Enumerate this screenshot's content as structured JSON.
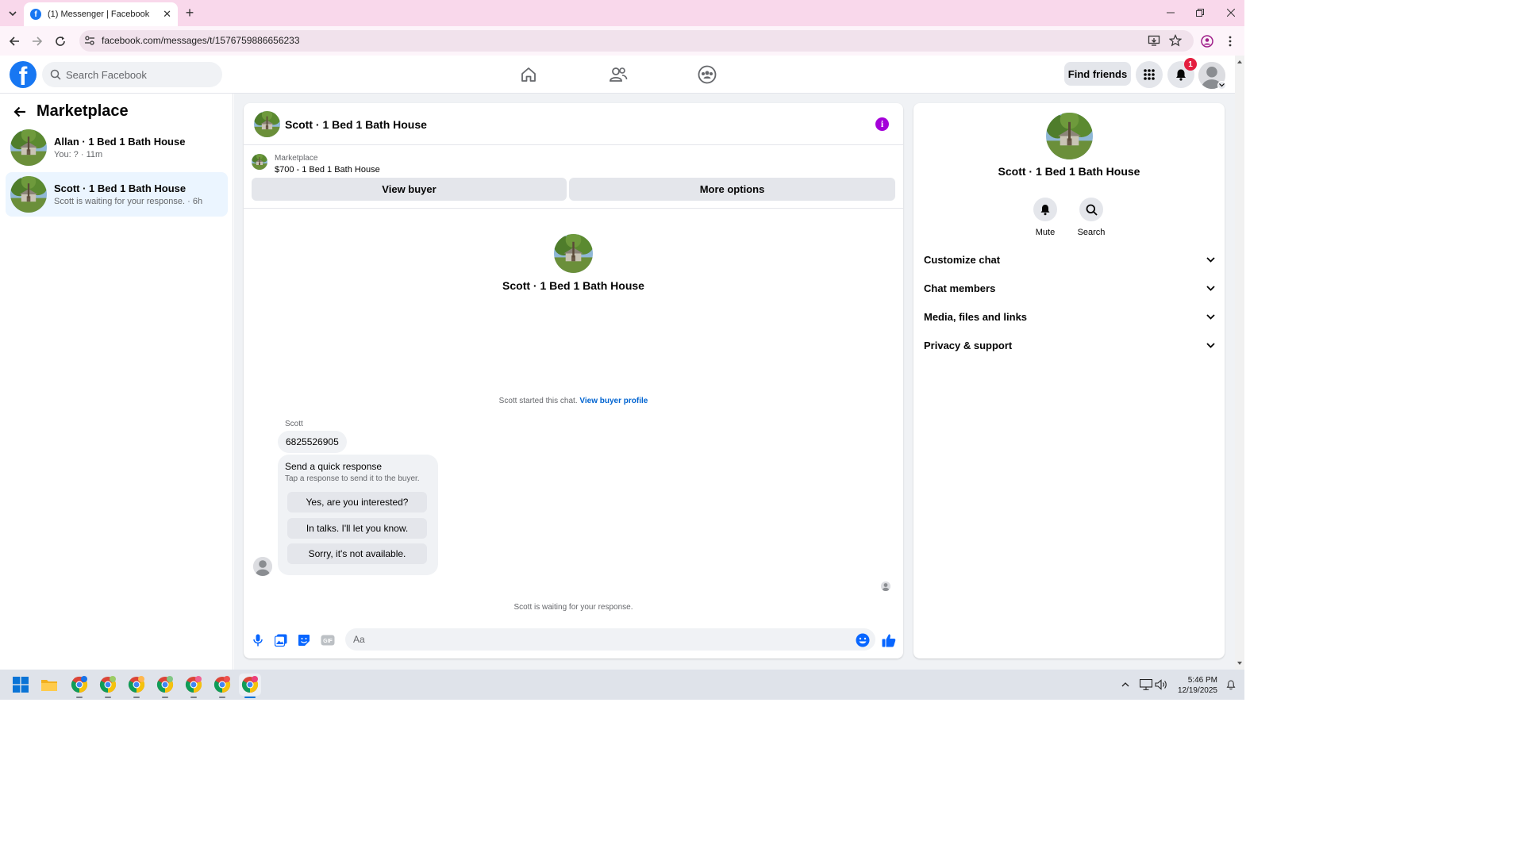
{
  "browser": {
    "tab_title": "(1) Messenger | Facebook",
    "url": "facebook.com/messages/t/1576759886656233"
  },
  "fb_header": {
    "search_placeholder": "Search Facebook",
    "find_friends": "Find friends",
    "notification_count": "1"
  },
  "sidebar": {
    "title": "Marketplace",
    "conversations": [
      {
        "name": "Allan · 1 Bed 1 Bath House",
        "preview": "You: ? · 11m",
        "active": false
      },
      {
        "name": "Scott · 1 Bed 1 Bath House",
        "preview": "Scott is waiting for your response. · 6h",
        "active": true
      }
    ]
  },
  "chat": {
    "header_title": "Scott · 1 Bed 1 Bath House",
    "listing_source": "Marketplace",
    "listing_detail": "$700 - 1 Bed 1 Bath House",
    "view_buyer": "View buyer",
    "more_options": "More options",
    "intro_name": "Scott · 1 Bed 1 Bath House",
    "started_text": "Scott started this chat.",
    "view_buyer_profile": "View buyer profile",
    "sender": "Scott",
    "message": "6825526905",
    "quick_response": {
      "title": "Send a quick response",
      "subtitle": "Tap a response to send it to the buyer.",
      "options": [
        "Yes, are you interested?",
        "In talks. I'll let you know.",
        "Sorry, it's not available."
      ]
    },
    "waiting": "Scott is waiting for your response.",
    "composer_placeholder": "Aa"
  },
  "details": {
    "name": "Scott · 1 Bed 1 Bath House",
    "actions": [
      "Mute",
      "Search"
    ],
    "sections": [
      "Customize chat",
      "Chat members",
      "Media, files and links",
      "Privacy & support"
    ]
  },
  "taskbar": {
    "time": "5:46 PM",
    "date": "12/19/2025"
  },
  "colors": {
    "fb_blue": "#1877f2",
    "tab_strip": "#f9d8eb",
    "info_purple": "#a400d9",
    "badge_red": "#e41e3f",
    "link_blue": "#0064d1"
  }
}
